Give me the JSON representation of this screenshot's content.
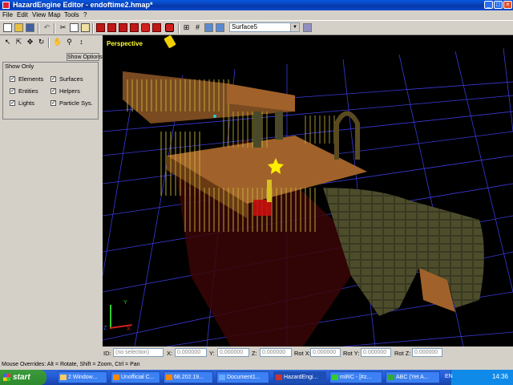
{
  "window": {
    "title": "HazardEngine Editor - endoftime2.hmap*"
  },
  "menu": [
    "File",
    "Edit",
    "View",
    "Map",
    "Tools",
    "?"
  ],
  "toolbar": {
    "surface_selected": "Surface5"
  },
  "left_panel": {
    "show_options_label": "Show Options",
    "group_title": "Show Only",
    "options": [
      {
        "label": "Elements",
        "checked": true
      },
      {
        "label": "Surfaces",
        "checked": true
      },
      {
        "label": "Entities",
        "checked": true
      },
      {
        "label": "Helpers",
        "checked": true
      },
      {
        "label": "Lights",
        "checked": true
      },
      {
        "label": "Particle Sys.",
        "checked": true
      }
    ]
  },
  "viewport": {
    "label": "Perspective",
    "axis_y": "Y",
    "axis_x": "X",
    "axis_z": "Z"
  },
  "fields": {
    "id_label": "ID:",
    "id_value": "(no selection)",
    "x_label": "X:",
    "x_value": "0.000000",
    "y_label": "Y:",
    "y_value": "0.000000",
    "z_label": "Z:",
    "z_value": "0.000000",
    "rotx_label": "Rot X:",
    "rotx_value": "0.000000",
    "roty_label": "Rot Y:",
    "roty_value": "0.000000",
    "rotz_label": "Rot Z:",
    "rotz_value": "0.000000"
  },
  "status": "Mouse Overrides: Alt = Rotate, Shift = Zoom, Ctrl = Pan",
  "taskbar": {
    "start": "start",
    "tasks": [
      "2 Window...",
      "Unofficial C...",
      "68.202.19...",
      "Document1...",
      "HazardEngi...",
      "mIRC - [#z...",
      "ABC (Yet A..."
    ],
    "lang": "EN",
    "time": "14:36"
  },
  "colors": {
    "titlebar": "#0a58e0",
    "viewport_bg": "#000000",
    "grid": "#3a3ad8",
    "railing": "#c8b43a",
    "floor": "#a0622a",
    "label": "#ffff33"
  }
}
